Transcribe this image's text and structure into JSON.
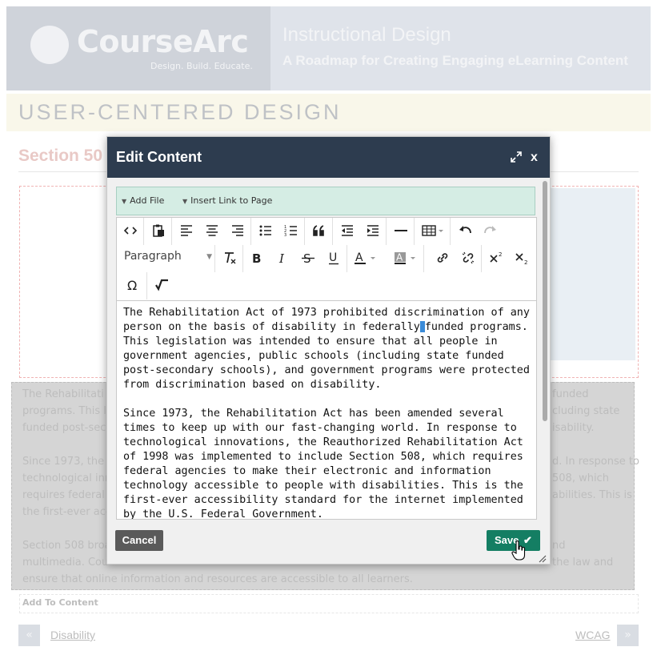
{
  "header": {
    "logo_text": "CourseArc",
    "logo_tagline": "Design. Build. Educate.",
    "title": "Instructional Design",
    "subtitle": "A Roadmap for Creating Engaging eLearning Content"
  },
  "banner": {
    "title": "USER-CENTERED DESIGN"
  },
  "section": {
    "title": "Section 50"
  },
  "background_text": {
    "lines": [
      "The Rehabilitati",
      "programs. This le",
      "funded post-seco",
      "",
      "Since 1973, the R",
      "technological inno",
      "requires federal a",
      "the first-ever acc",
      "",
      "Section 508 broa",
      "multimedia. Cou",
      "ensure that online information and resources are accessible to all learners."
    ],
    "right_lines": [
      "funded",
      "cluding state",
      "isability.",
      "",
      "d. In response to",
      "508, which",
      "abilities. This is",
      "",
      "",
      "nd",
      "the law and"
    ],
    "add_to_content": "Add To Content"
  },
  "navigation": {
    "prev_symbol": "«",
    "prev_label": "Disability",
    "next_label": "WCAG",
    "next_symbol": "»"
  },
  "modal": {
    "title": "Edit Content",
    "close_label": "x",
    "file_bar": {
      "add_file": "Add File",
      "insert_link": "Insert Link to Page"
    },
    "toolbar": {
      "format_select": "Paragraph"
    },
    "content": {
      "p1_before": "The Rehabilitation Act of 1973 prohibited discrimination of any person on the basis of disability in federally",
      "p1_after": "funded programs. This legislation was intended to ensure that all people in government agencies, public schools (including state funded post-secondary schools), and government programs were protected from discrimination based on disability.",
      "p2": "Since 1973, the Rehabilitation Act has been amended several times to keep up with our fast-changing world. In response to technological innovations, the Reauthorized Rehabilitation Act of 1998 was implemented to include Section 508, which requires federal agencies to make their electronic and information technology accessible to people with disabilities. This is the first-ever accessibility standard for the internet implemented by the U.S. Federal Government."
    },
    "cancel_label": "Cancel",
    "save_label": "Save"
  },
  "colors": {
    "modal_header": "#2d3c4f",
    "save_button": "#147e63",
    "cancel_button": "#5a5a5a",
    "file_bar": "#d5ede4"
  }
}
